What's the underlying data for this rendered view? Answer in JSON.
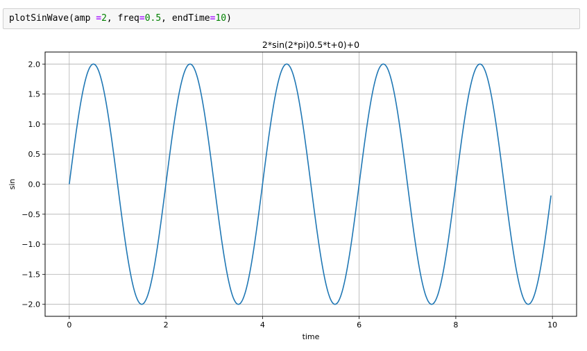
{
  "code_cell": {
    "tokens": [
      {
        "text": "plotSinWave(amp ",
        "kind": "plain"
      },
      {
        "text": "=",
        "kind": "op"
      },
      {
        "text": "2",
        "kind": "num"
      },
      {
        "text": ", freq",
        "kind": "plain"
      },
      {
        "text": "=",
        "kind": "op"
      },
      {
        "text": "0.5",
        "kind": "num"
      },
      {
        "text": ", endTime",
        "kind": "plain"
      },
      {
        "text": "=",
        "kind": "op"
      },
      {
        "text": "10",
        "kind": "num"
      },
      {
        "text": ")",
        "kind": "plain"
      }
    ]
  },
  "chart_data": {
    "type": "line",
    "title": "2*sin(2*pi)0.5*t+0)+0",
    "xlabel": "time",
    "ylabel": "sin",
    "xlim": [
      -0.5,
      10.5
    ],
    "ylim": [
      -2.2,
      2.2
    ],
    "xticks": [
      0,
      2,
      4,
      6,
      8,
      10
    ],
    "yticks": [
      2.0,
      1.5,
      1.0,
      0.5,
      0.0,
      -0.5,
      -1.0,
      -1.5,
      -2.0
    ],
    "xtick_labels": [
      "0",
      "2",
      "4",
      "6",
      "8",
      "10"
    ],
    "ytick_labels": [
      "2.0",
      "1.5",
      "1.0",
      "0.5",
      "0.0",
      "−0.5",
      "−1.0",
      "−1.5",
      "−2.0"
    ],
    "grid": true,
    "series": [
      {
        "color": "#1f77b4",
        "function": {
          "amplitude": 2,
          "frequency": 0.5,
          "phase": 0,
          "offset": 0
        },
        "x_start": 0,
        "x_end": 9.97
      }
    ]
  }
}
